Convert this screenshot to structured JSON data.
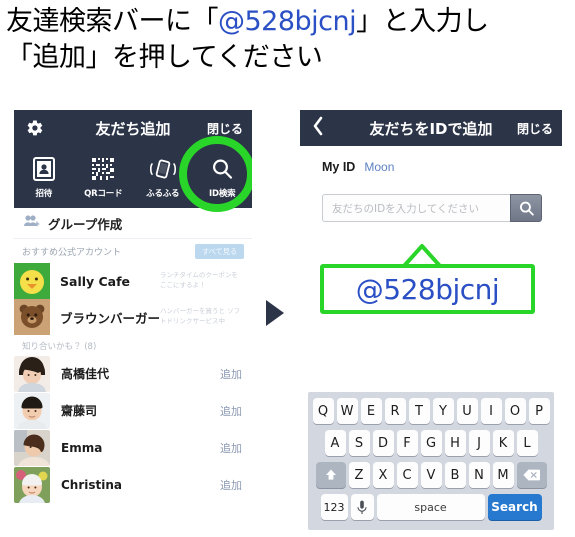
{
  "instruction": {
    "line1_pre": "友達検索バーに「",
    "line1_id": "@528bjcnj",
    "line1_post": "」と入力し",
    "line2": "「追加」を押してください"
  },
  "colors": {
    "navy": "#2c3447",
    "highlight_green": "#2ad52a",
    "link_blue": "#2b4fc4",
    "search_key_blue": "#2679cf",
    "add_link": "#8d9bb3"
  },
  "left_phone": {
    "navbar": {
      "gear_icon": "gear-icon",
      "title": "友だち追加",
      "close_label": "閉じる"
    },
    "tabs": [
      {
        "label": "招待",
        "icon": "contact-card-icon"
      },
      {
        "label": "QRコード",
        "icon": "qr-code-icon"
      },
      {
        "label": "ふるふる",
        "icon": "shake-phone-icon"
      },
      {
        "label": "ID検索",
        "icon": "search-icon",
        "highlighted": true
      }
    ],
    "group_row": {
      "label": "グループ作成",
      "icon": "group-add-icon"
    },
    "official_section": {
      "title": "おすすめ公式アカウント",
      "see_all_label": "すべて見る",
      "accounts": [
        {
          "name": "Sally Cafe",
          "desc": "ランチタイムのクーポンを\nここにするよ！"
        },
        {
          "name": "ブラウンバーガー",
          "desc": "ハンバーガーを買うと\nソフトドリンクサービス中"
        }
      ]
    },
    "suggestions": {
      "title": "知り合いかも？",
      "count": "(8)",
      "add_label": "追加",
      "people": [
        {
          "name": "高橋佳代"
        },
        {
          "name": "齋藤司"
        },
        {
          "name": "Emma"
        },
        {
          "name": "Christina"
        }
      ]
    }
  },
  "arrow": {
    "icon": "play-triangle-icon"
  },
  "right_phone": {
    "navbar": {
      "back_icon": "chevron-left-icon",
      "title": "友だちをIDで追加",
      "close_label": "閉じる"
    },
    "my_id": {
      "label": "My ID",
      "value": "Moon"
    },
    "search": {
      "placeholder": "友だちのIDを入力してください",
      "value": "",
      "button_icon": "search-icon"
    },
    "callout": {
      "text": "@528bjcnj"
    },
    "keyboard": {
      "row1": [
        "Q",
        "W",
        "E",
        "R",
        "T",
        "Y",
        "U",
        "I",
        "O",
        "P"
      ],
      "row2": [
        "A",
        "S",
        "D",
        "F",
        "G",
        "H",
        "J",
        "K",
        "L"
      ],
      "row3": [
        "Z",
        "X",
        "C",
        "V",
        "B",
        "N",
        "M"
      ],
      "shift_icon": "shift-arrow-icon",
      "backspace_icon": "backspace-icon",
      "numbers_label": "123",
      "mic_icon": "microphone-icon",
      "space_label": "space",
      "search_label": "Search"
    }
  }
}
